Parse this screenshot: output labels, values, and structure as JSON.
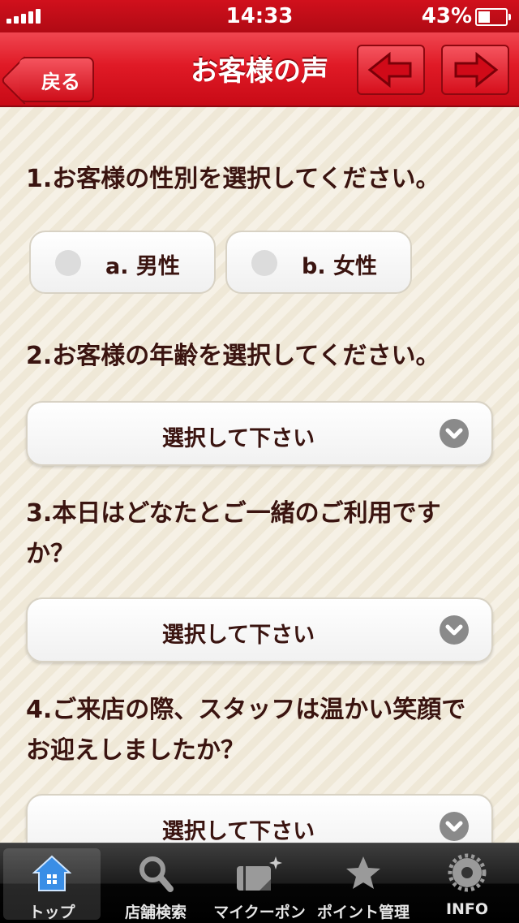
{
  "status_bar": {
    "time": "14:33",
    "battery_percent": "43%",
    "battery_level": 0.43
  },
  "nav": {
    "back_label": "戻る",
    "title": "お客様の声",
    "prev_icon": "arrow-left-icon",
    "next_icon": "arrow-right-icon"
  },
  "questions": [
    {
      "text": "1.お客様の性別を選択してください。",
      "options": [
        "a. 男性",
        "b. 女性"
      ]
    },
    {
      "text": "2.お客様の年齢を選択してください。",
      "select_value": "選択して下さい"
    },
    {
      "text_line1": "3.本日はどなたとご一緒のご利用です",
      "text_line2": "か？",
      "select_value": "選択して下さい"
    },
    {
      "text_line1": "4.ご来店の際、スタッフは温かい笑顔で",
      "text_line2": "お迎えしましたか？",
      "select_value": "選択して下さい"
    }
  ],
  "tabbar": {
    "tabs": [
      {
        "label": "トップ",
        "icon": "home-icon",
        "active": true
      },
      {
        "label": "店舗検索",
        "icon": "search-icon",
        "active": false
      },
      {
        "label": "マイクーポン",
        "icon": "coupon-icon",
        "active": false
      },
      {
        "label": "ポイント管理",
        "icon": "star-icon",
        "active": false
      },
      {
        "label": "INFO",
        "icon": "gear-icon",
        "active": false
      }
    ]
  },
  "colors": {
    "nav_red": "#e01a26",
    "text_brown": "#3a1410",
    "background": "#f4efe3"
  }
}
